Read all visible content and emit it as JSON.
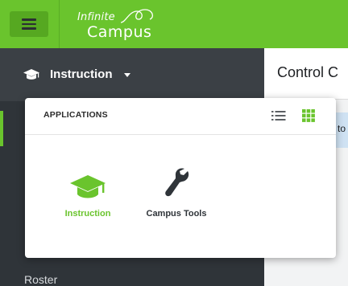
{
  "topbar": {
    "logo_line1": "Infinite",
    "logo_line2": "Campus"
  },
  "sidebar": {
    "tool_label": "Instruction",
    "items": [
      {
        "label": "Roster"
      }
    ]
  },
  "main": {
    "title": "Control C",
    "banner_fragment": "to"
  },
  "popup": {
    "title": "APPLICATIONS",
    "view_modes": [
      "list-icon",
      "grid-icon"
    ],
    "active_view": "grid",
    "apps": [
      {
        "label": "Instruction",
        "icon": "graduation-cap-icon",
        "color": "#6ac42d",
        "active": true
      },
      {
        "label": "Campus Tools",
        "icon": "wrench-icon",
        "color": "#2f3439",
        "active": false
      }
    ]
  },
  "colors": {
    "brand_green": "#6ac42d",
    "sidebar_dark": "#2f3439",
    "sidebar_header": "#3b4045"
  }
}
